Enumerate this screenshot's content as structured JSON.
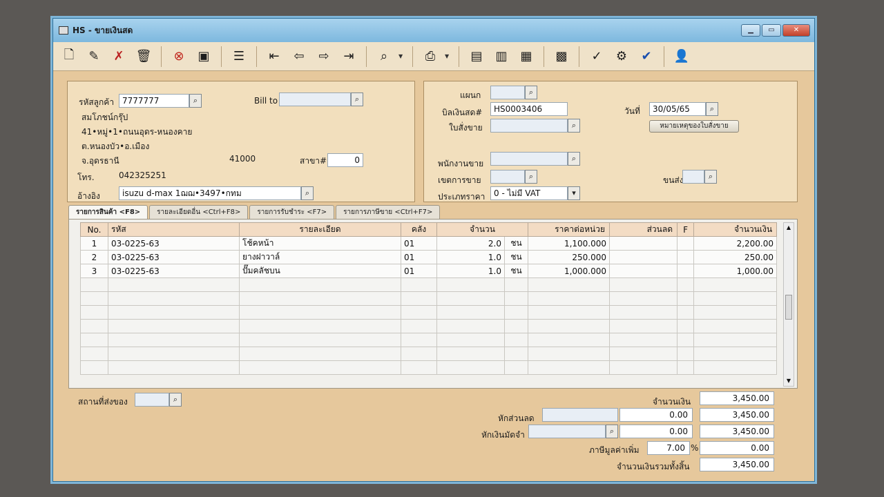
{
  "window": {
    "title": "HS - ขายเงินสด"
  },
  "toolbar": {
    "icons": [
      "new-icon",
      "edit-icon",
      "delete-doc-icon",
      "trash-icon",
      "cancel-icon",
      "save-icon",
      "find-icon",
      "first-icon",
      "prev-icon",
      "next-icon",
      "last-icon",
      "search-icon",
      "print-icon",
      "export-icon",
      "import-icon",
      "report-icon",
      "calendar-icon",
      "approve-icon",
      "tools-icon",
      "ok-icon",
      "user-icon"
    ]
  },
  "customer": {
    "code_label": "รหัสลูกค้า",
    "code_value": "7777777",
    "billto_label": "Bill to",
    "name": "สมโภชน์กรุ๊ป",
    "addr1": "41•หมู่•1•ถนนอุดร-หนองคาย",
    "addr2": "ต.หนองบัว•อ.เมือง",
    "province": "จ.อุดรธานี",
    "postcode": "41000",
    "branch_label": "สาขา#",
    "branch_value": "0",
    "phone_label": "โทร.",
    "phone_value": "042325251",
    "ref_label": "อ้างอิง",
    "ref_value": "isuzu d-max 1ฌฌ•3497•กทม"
  },
  "doc": {
    "dept_label": "แผนก",
    "bill_label": "บิลเงินสด#",
    "bill_value": "HS0003406",
    "date_label": "วันที่",
    "date_value": "30/05/65",
    "order_label": "ใบสั่งขาย",
    "order_note_button": "หมายเหตุของใบสั่งขาย",
    "sales_label": "พนักงานขาย",
    "area_label": "เขตการขาย",
    "ship_label": "ขนส่งโดย",
    "price_type_label": "ประเภทราคา",
    "price_type_value": "0 - ไม่มี VAT"
  },
  "tabs": [
    {
      "label": "รายการสินค้า <F8>"
    },
    {
      "label": "รายละเอียดอื่น <Ctrl+F8>"
    },
    {
      "label": "รายการรับชำระ <F7>"
    },
    {
      "label": "รายการภาษีขาย <Ctrl+F7>"
    }
  ],
  "grid": {
    "headers": [
      "No.",
      "รหัส",
      "รายละเอียด",
      "คลัง",
      "จำนวน",
      "ราคาต่อหน่วย",
      "ส่วนลด",
      "F",
      "จำนวนเงิน"
    ],
    "rows": [
      {
        "no": "1",
        "code": "03-0225-63",
        "desc": "โช้คหน้า",
        "wh": "01",
        "qty": "2.0",
        "unit": "ชน",
        "price": "1,100.000",
        "disc": "",
        "f": "",
        "amount": "2,200.00"
      },
      {
        "no": "2",
        "code": "03-0225-63",
        "desc": "ยางฝาวาล์",
        "wh": "01",
        "qty": "1.0",
        "unit": "ชน",
        "price": "250.000",
        "disc": "",
        "f": "",
        "amount": "250.00"
      },
      {
        "no": "3",
        "code": "03-0225-63",
        "desc": "ปั๊มคลัชบน",
        "wh": "01",
        "qty": "1.0",
        "unit": "ชน",
        "price": "1,000.000",
        "disc": "",
        "f": "",
        "amount": "1,000.00"
      }
    ]
  },
  "footer": {
    "ship_place_label": "สถานที่ส่งของ",
    "total_label": "จำนวนเงิน",
    "total_value": "3,450.00",
    "discount_label": "หักส่วนลด",
    "discount_value": "0.00",
    "after_discount": "3,450.00",
    "deposit_label": "หักเงินมัดจำ",
    "deposit_value": "0.00",
    "after_deposit": "3,450.00",
    "vat_label": "ภาษีมูลค่าเพิ่ม",
    "vat_rate": "7.00",
    "vat_percent": "%",
    "vat_value": "0.00",
    "grand_label": "จำนวนเงินรวมทั้งสิ้น",
    "grand_value": "3,450.00"
  }
}
